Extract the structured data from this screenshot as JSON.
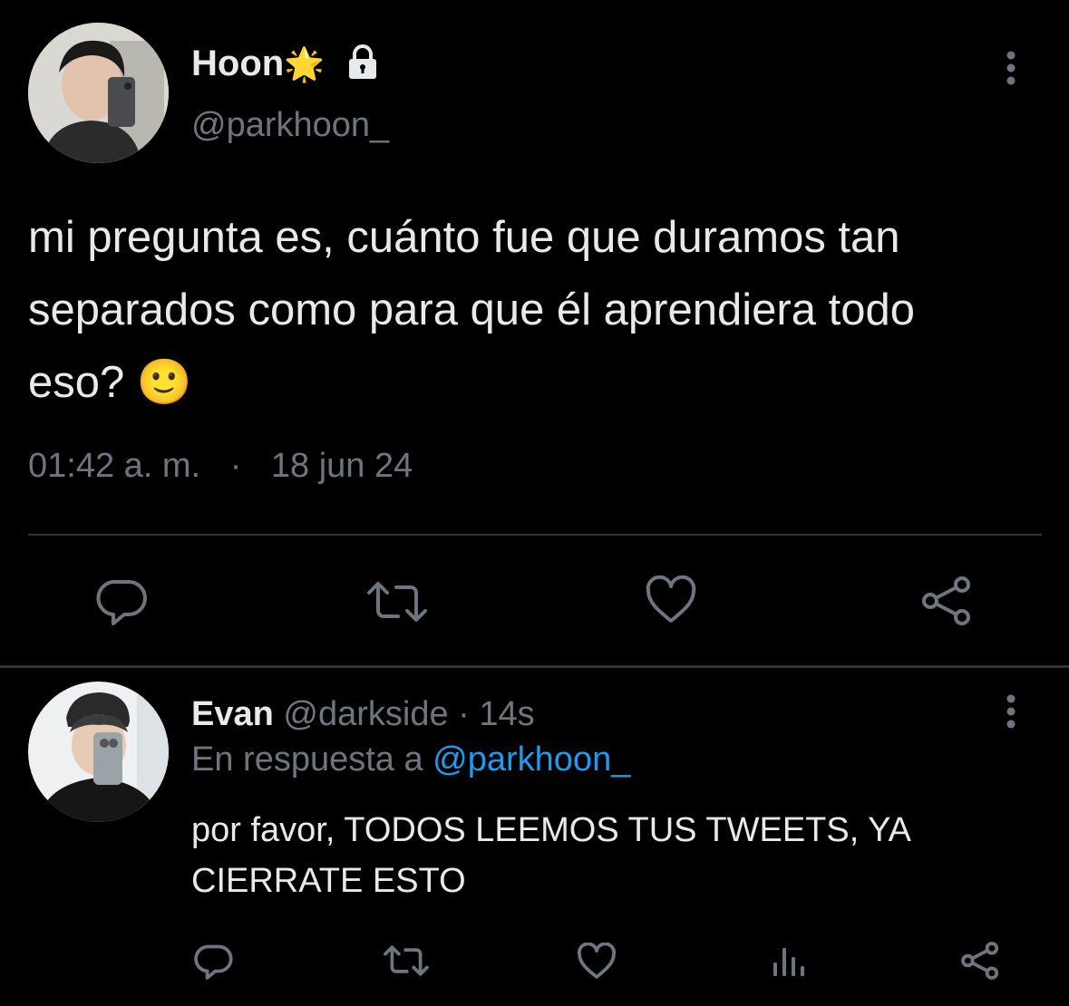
{
  "main_tweet": {
    "display_name": "Hoon",
    "badge_emoji": "🌟",
    "handle": "@parkhoon_",
    "text_line1": "mi pregunta es, cuánto fue que duramos tan",
    "text_line2": "separados como para que él aprendiera todo",
    "text_line3": "eso? 🙂",
    "time": "01:42 a. m.",
    "dot": "·",
    "date": "18 jun 24"
  },
  "reply": {
    "display_name": "Evan",
    "handle": "@darkside",
    "meta_sep": "·",
    "age": "14s",
    "in_reply_prefix": "En respuesta a",
    "in_reply_handle": "@parkhoon_",
    "text_line1": "por favor, TODOS LEEMOS TUS TWEETS, YA",
    "text_line2": "CIERRATE ESTO"
  },
  "icons": {
    "lock": "lock-icon",
    "more": "more-vertical-icon",
    "reply": "reply-icon",
    "retweet": "retweet-icon",
    "like": "heart-icon",
    "share": "share-icon",
    "views": "views-icon"
  },
  "colors": {
    "background": "#000000",
    "text": "#e7e9ea",
    "muted": "#6e767d",
    "link": "#1d9bf0",
    "divider": "#2f3336"
  }
}
